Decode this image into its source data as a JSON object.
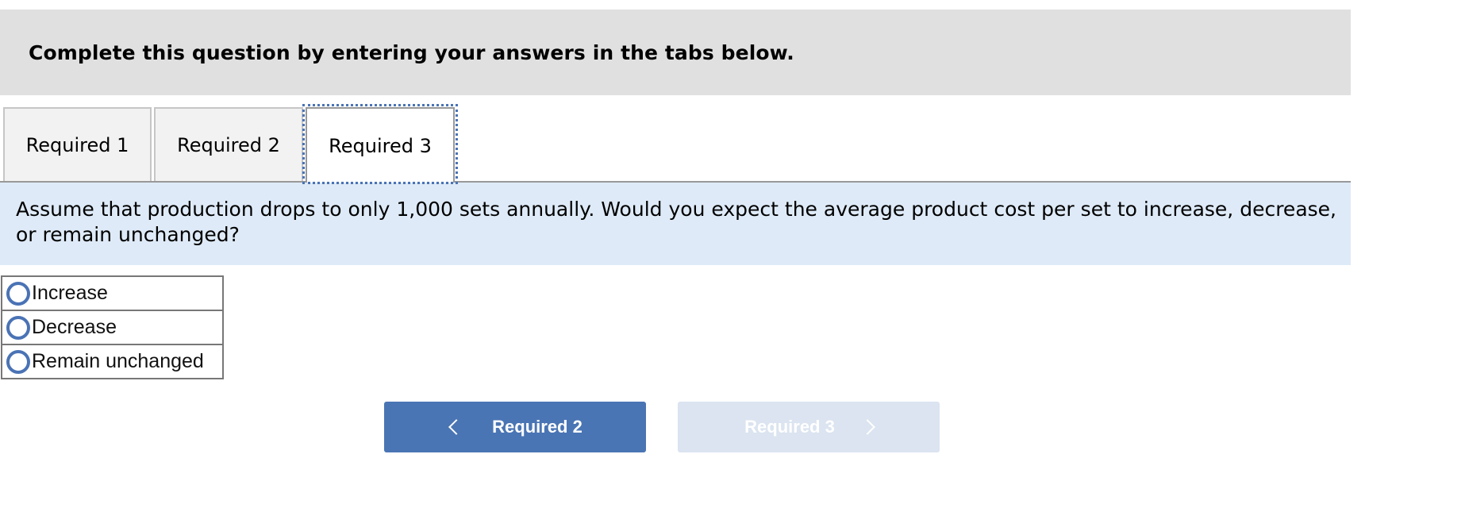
{
  "header": {
    "instruction": "Complete this question by entering your answers in the tabs below."
  },
  "tabs": [
    {
      "label": "Required 1",
      "active": false
    },
    {
      "label": "Required 2",
      "active": false
    },
    {
      "label": "Required 3",
      "active": true
    }
  ],
  "question": {
    "prompt": "Assume that production drops to only 1,000 sets annually. Would you expect the average product cost per set to increase, decrease, or remain unchanged?",
    "options": [
      {
        "label": "Increase",
        "selected": false
      },
      {
        "label": "Decrease",
        "selected": false
      },
      {
        "label": "Remain unchanged",
        "selected": false
      }
    ]
  },
  "navigation": {
    "prev_label": "Required 2",
    "next_label": "Required 3",
    "next_disabled": true
  },
  "colors": {
    "accent": "#4a75b4",
    "disabled_button": "#dbe4f0",
    "prompt_bg": "#deeaf7",
    "header_bg": "#e0e0e0"
  }
}
